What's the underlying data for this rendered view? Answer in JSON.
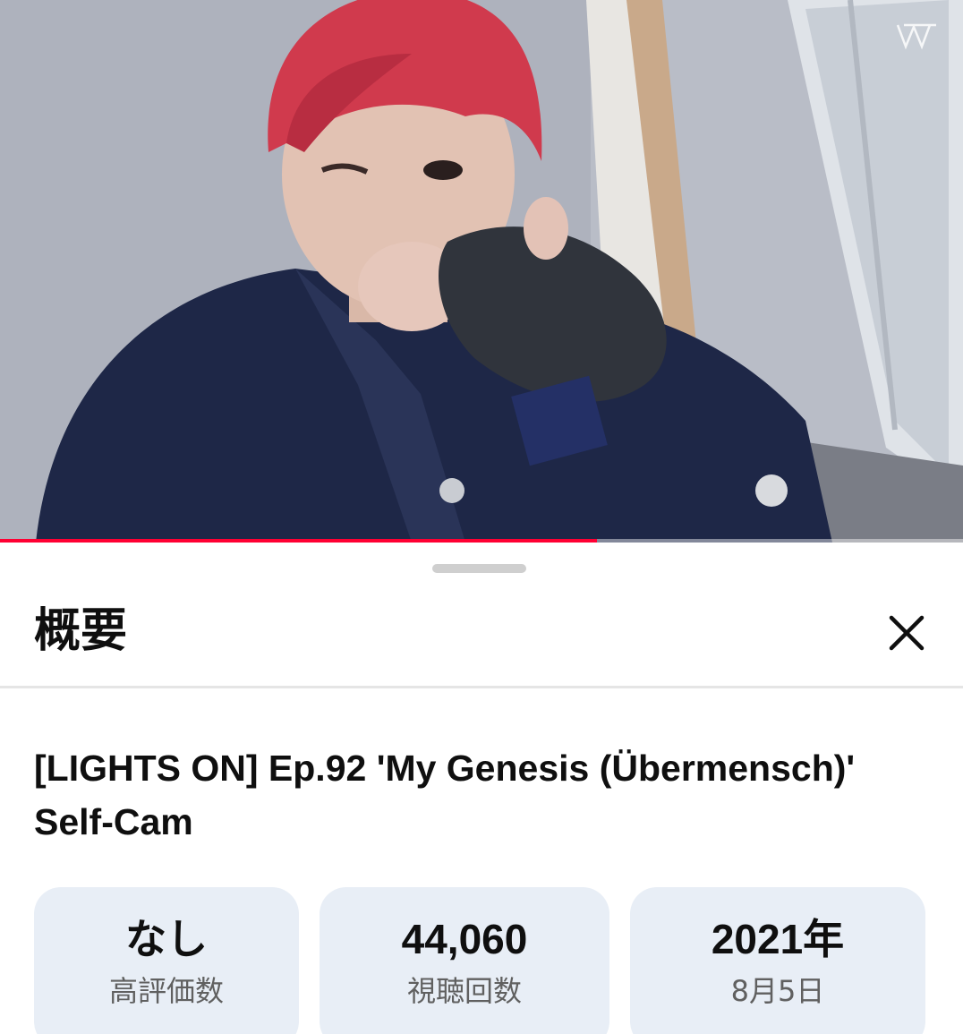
{
  "player": {
    "progress_fraction": 0.62,
    "progress_color": "#ff0033"
  },
  "sheet": {
    "title": "概要",
    "close_icon": "close-icon"
  },
  "video": {
    "title": "[LIGHTS ON] Ep.92 'My Genesis (Übermensch)' Self-Cam"
  },
  "stats": [
    {
      "value": "なし",
      "label": "高評価数"
    },
    {
      "value": "44,060",
      "label": "視聴回数"
    },
    {
      "value": "2021年",
      "label": "8月5日"
    }
  ]
}
